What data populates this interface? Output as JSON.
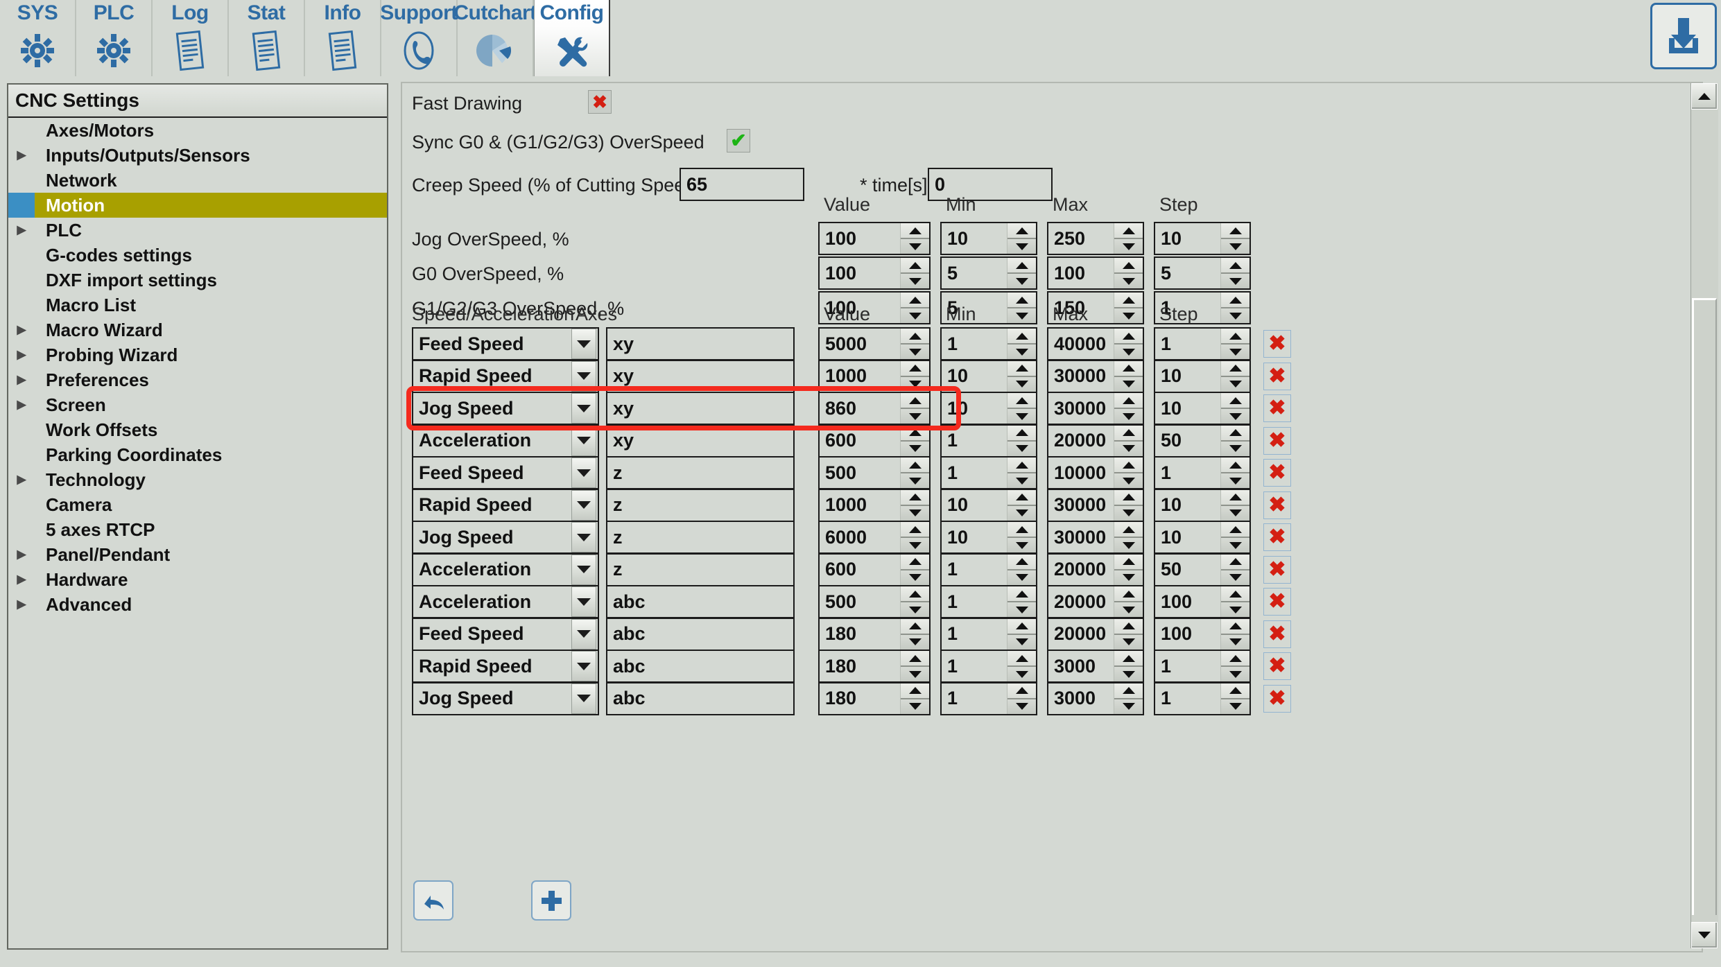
{
  "toolbar": {
    "tabs": [
      {
        "label": "SYS",
        "icon": "gear-icon"
      },
      {
        "label": "PLC",
        "icon": "gear-icon"
      },
      {
        "label": "Log",
        "icon": "document-lines-icon"
      },
      {
        "label": "Stat",
        "icon": "document-lines-icon"
      },
      {
        "label": "Info",
        "icon": "document-lines-icon"
      },
      {
        "label": "Support",
        "icon": "phone-icon"
      },
      {
        "label": "Cutchart",
        "icon": "pie-chart-icon"
      },
      {
        "label": "Config",
        "icon": "tools-icon"
      }
    ],
    "active_tab": "Config",
    "save_button": {
      "icon": "download-save-icon"
    }
  },
  "sidebar": {
    "header": "CNC Settings",
    "selected": "Motion",
    "items": [
      {
        "label": "Axes/Motors",
        "expandable": false
      },
      {
        "label": "Inputs/Outputs/Sensors",
        "expandable": true
      },
      {
        "label": "Network",
        "expandable": false
      },
      {
        "label": "Motion",
        "expandable": false
      },
      {
        "label": "PLC",
        "expandable": true
      },
      {
        "label": "G-codes settings",
        "expandable": false
      },
      {
        "label": "DXF import settings",
        "expandable": false
      },
      {
        "label": "Macro List",
        "expandable": false
      },
      {
        "label": "Macro Wizard",
        "expandable": true
      },
      {
        "label": "Probing Wizard",
        "expandable": true
      },
      {
        "label": "Preferences",
        "expandable": true
      },
      {
        "label": "Screen",
        "expandable": true
      },
      {
        "label": "Work Offsets",
        "expandable": false
      },
      {
        "label": "Parking Coordinates",
        "expandable": false
      },
      {
        "label": "Technology",
        "expandable": true
      },
      {
        "label": "Camera",
        "expandable": false
      },
      {
        "label": "5 axes RTCP",
        "expandable": false
      },
      {
        "label": "Panel/Pendant",
        "expandable": true
      },
      {
        "label": "Hardware",
        "expandable": true
      },
      {
        "label": "Advanced",
        "expandable": true
      }
    ]
  },
  "main": {
    "fast_drawing": {
      "label": "Fast Drawing",
      "checked": false,
      "mark": "✖"
    },
    "sync_overspeed": {
      "label": "Sync G0 & (G1/G2/G3) OverSpeed",
      "checked": true,
      "mark": "✔"
    },
    "creep_speed": {
      "label": "Creep Speed (% of Cutting Speed)",
      "value": "65"
    },
    "creep_time": {
      "label": "* time[s]",
      "value": "0"
    },
    "overspeed_headers": {
      "value": "Value",
      "min": "Min",
      "max": "Max",
      "step": "Step"
    },
    "overspeed_rows": [
      {
        "label": "Jog OverSpeed, %",
        "value": "100",
        "min": "10",
        "max": "250",
        "step": "10"
      },
      {
        "label": "G0 OverSpeed, %",
        "value": "100",
        "min": "5",
        "max": "100",
        "step": "5"
      },
      {
        "label": "G1/G2/G3 OverSpeed, %",
        "value": "100",
        "min": "5",
        "max": "150",
        "step": "1"
      }
    ],
    "table_headers": {
      "type": "Speed/Acceleration",
      "axes": "Axes",
      "value": "Value",
      "min": "Min",
      "max": "Max",
      "step": "Step"
    },
    "table_rows": [
      {
        "type": "Feed Speed",
        "axes": "xy",
        "value": "5000",
        "min": "1",
        "max": "40000",
        "step": "1",
        "highlighted": false
      },
      {
        "type": "Rapid Speed",
        "axes": "xy",
        "value": "1000",
        "min": "10",
        "max": "30000",
        "step": "10",
        "highlighted": false
      },
      {
        "type": "Jog Speed",
        "axes": "xy",
        "value": "860",
        "min": "10",
        "max": "30000",
        "step": "10",
        "highlighted": true
      },
      {
        "type": "Acceleration",
        "axes": "xy",
        "value": "600",
        "min": "1",
        "max": "20000",
        "step": "50",
        "highlighted": false
      },
      {
        "type": "Feed Speed",
        "axes": "z",
        "value": "500",
        "min": "1",
        "max": "10000",
        "step": "1",
        "highlighted": false
      },
      {
        "type": "Rapid Speed",
        "axes": "z",
        "value": "1000",
        "min": "10",
        "max": "30000",
        "step": "10",
        "highlighted": false
      },
      {
        "type": "Jog Speed",
        "axes": "z",
        "value": "6000",
        "min": "10",
        "max": "30000",
        "step": "10",
        "highlighted": false
      },
      {
        "type": "Acceleration",
        "axes": "z",
        "value": "600",
        "min": "1",
        "max": "20000",
        "step": "50",
        "highlighted": false
      },
      {
        "type": "Acceleration",
        "axes": "abc",
        "value": "500",
        "min": "1",
        "max": "20000",
        "step": "100",
        "highlighted": false
      },
      {
        "type": "Feed Speed",
        "axes": "abc",
        "value": "180",
        "min": "1",
        "max": "20000",
        "step": "100",
        "highlighted": false
      },
      {
        "type": "Rapid Speed",
        "axes": "abc",
        "value": "180",
        "min": "1",
        "max": "3000",
        "step": "1",
        "highlighted": false
      },
      {
        "type": "Jog Speed",
        "axes": "abc",
        "value": "180",
        "min": "1",
        "max": "3000",
        "step": "1",
        "highlighted": false
      }
    ],
    "delete_row_mark": "✖",
    "footer_buttons": [
      {
        "name": "undo-button",
        "icon": "undo-arrow-icon"
      },
      {
        "name": "add-row-button",
        "icon": "plus-icon"
      }
    ]
  },
  "colors": {
    "background": "#d4d9d3",
    "accent_blue": "#2e6ca4",
    "selection_olive": "#a8a000",
    "selection_indicator_blue": "#3b8fc4",
    "highlight_red": "#f42a1e",
    "check_green": "#1db415",
    "cross_red": "#d41f12"
  }
}
